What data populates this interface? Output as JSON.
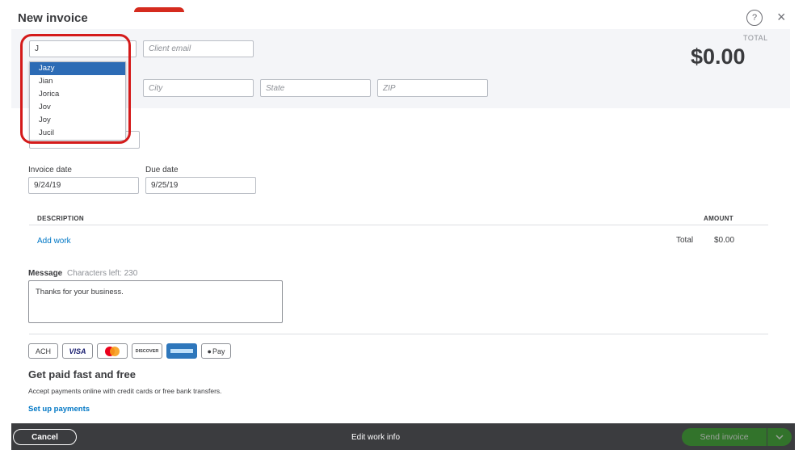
{
  "header": {
    "title": "New invoice",
    "help_icon": "?",
    "close_icon": "×"
  },
  "customer": {
    "search_value": "J",
    "dropdown_options": [
      "Jazy",
      "Jian",
      "Jorica",
      "Jov",
      "Joy",
      "Jucil"
    ],
    "selected_index": 0,
    "email_placeholder": "Client email",
    "city_placeholder": "City",
    "state_placeholder": "State",
    "zip_placeholder": "ZIP"
  },
  "total": {
    "label": "TOTAL",
    "amount": "$0.00"
  },
  "dates": {
    "invoice_label": "Invoice date",
    "invoice_value": "9/24/19",
    "due_label": "Due date",
    "due_value": "9/25/19"
  },
  "table": {
    "description_header": "DESCRIPTION",
    "amount_header": "AMOUNT",
    "add_work": "Add work",
    "total_label": "Total",
    "total_value": "$0.00"
  },
  "message": {
    "label": "Message",
    "chars_left": "Characters left: 230",
    "value": "Thanks for your business."
  },
  "payments": {
    "cards": [
      "ACH",
      "VISA",
      "Mastercard",
      "DISCOVER",
      "AMEX",
      "Pay"
    ],
    "heading": "Get paid fast and free",
    "subtext": "Accept payments online with credit cards or free bank transfers.",
    "setup_link": "Set up payments"
  },
  "footer": {
    "cancel": "Cancel",
    "edit_work_info": "Edit work info",
    "send_invoice": "Send invoice"
  },
  "colors": {
    "accent_blue": "#0077c5",
    "selection": "#2c6bb5",
    "highlight_red": "#d41a1a",
    "send_green": "#2ca01c",
    "footer_bg": "#3b3c3f"
  }
}
